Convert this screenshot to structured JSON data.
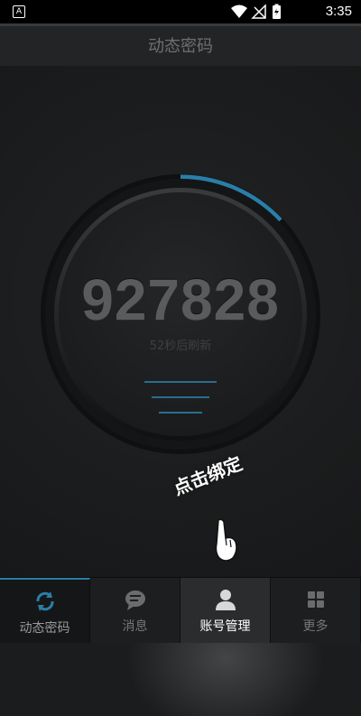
{
  "status_bar": {
    "time": "3:35",
    "app_icon_letter": "A"
  },
  "header": {
    "title": "动态密码"
  },
  "dial": {
    "code": "927828",
    "refresh_text": "52秒后刷新",
    "progress_fraction": 0.13,
    "accent_color": "#2a7ea8"
  },
  "tip": {
    "text": "点击绑定"
  },
  "tabs": [
    {
      "label": "动态密码",
      "icon": "refresh-icon",
      "state": "active"
    },
    {
      "label": "消息",
      "icon": "chat-bubble-icon",
      "state": "normal"
    },
    {
      "label": "账号管理",
      "icon": "user-icon",
      "state": "highlight"
    },
    {
      "label": "更多",
      "icon": "grid-icon",
      "state": "normal"
    }
  ]
}
